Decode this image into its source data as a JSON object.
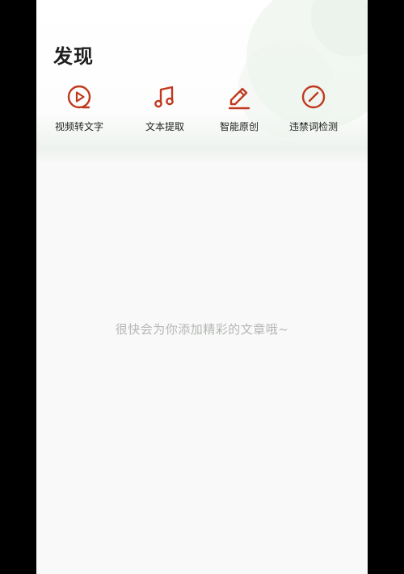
{
  "page": {
    "title": "发现"
  },
  "tools": [
    {
      "label": "视频转文字",
      "icon": "play-circle-icon"
    },
    {
      "label": "文本提取",
      "icon": "music-note-icon"
    },
    {
      "label": "智能原创",
      "icon": "pencil-icon"
    },
    {
      "label": "违禁词检测",
      "icon": "prohibited-icon"
    }
  ],
  "empty_state": {
    "message": "很快会为你添加精彩的文章哦~"
  },
  "colors": {
    "accent": "#c0391f",
    "title": "#1f1f1f",
    "muted_text": "#b4b7b4",
    "background": "#f8f9f8"
  }
}
